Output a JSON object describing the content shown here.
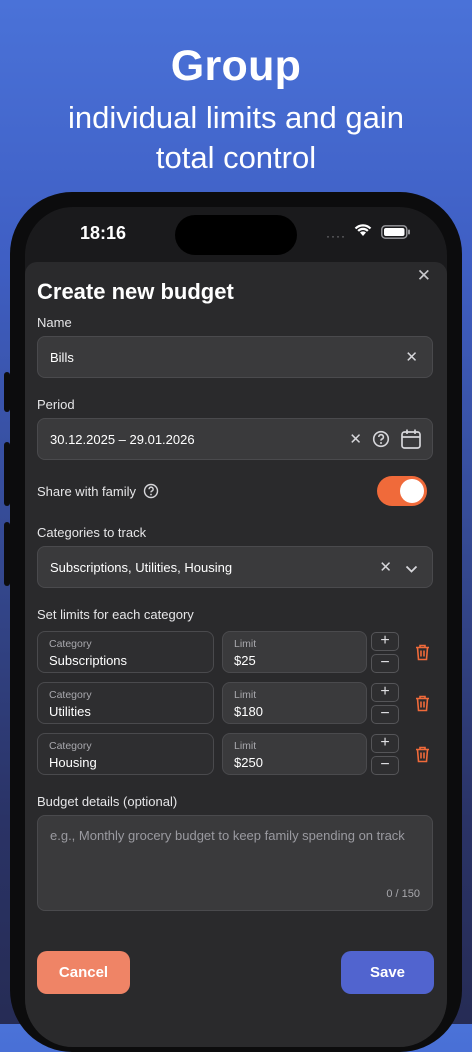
{
  "promo": {
    "title": "Group",
    "subtitle": "individual limits and gain total control"
  },
  "status_bar": {
    "time": "18:16",
    "signal_dots": "····",
    "wifi_icon": "wifi-icon",
    "battery_icon": "battery-icon"
  },
  "sheet": {
    "close_icon": "close-icon",
    "title": "Create new budget",
    "name": {
      "label": "Name",
      "value": "Bills",
      "clear_icon": "clear-icon"
    },
    "period": {
      "label": "Period",
      "value": "30.12.2025 – 29.01.2026",
      "icons": [
        "clear-icon",
        "help-icon",
        "calendar-icon"
      ]
    },
    "share": {
      "label": "Share with family",
      "help_icon": "help-icon",
      "enabled": true
    },
    "categories": {
      "label": "Categories to track",
      "value": "Subscriptions, Utilities, Housing",
      "icons": [
        "clear-icon",
        "chevron-down-icon"
      ]
    },
    "limits": {
      "label": "Set limits for each category",
      "category_caption": "Category",
      "limit_caption": "Limit",
      "rows": [
        {
          "category": "Subscriptions",
          "limit": "$25"
        },
        {
          "category": "Utilities",
          "limit": "$180"
        },
        {
          "category": "Housing",
          "limit": "$250"
        }
      ],
      "plus": "+",
      "minus": "−",
      "delete_icon": "trash-icon"
    },
    "details": {
      "label": "Budget details (optional)",
      "placeholder": "e.g., Monthly grocery budget to keep family spending on track",
      "counter": "0 / 150"
    },
    "actions": {
      "cancel": "Cancel",
      "save": "Save"
    },
    "colors": {
      "accent": "#f06a3a",
      "primary": "#5164cf",
      "cancel": "#ef8466",
      "delete": "#f06a3a"
    }
  }
}
